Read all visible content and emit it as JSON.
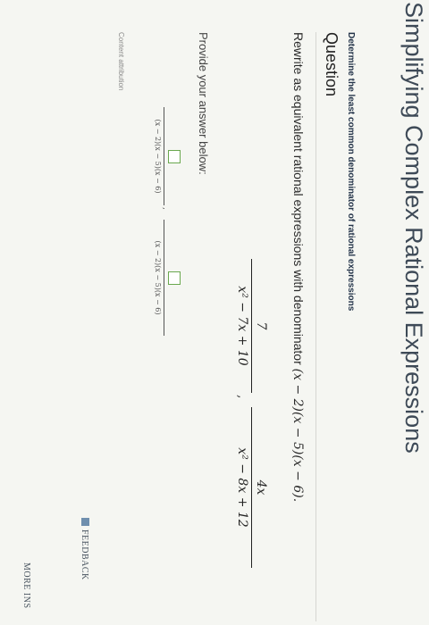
{
  "header": {
    "title": "Simplifying Complex Rational Expressions"
  },
  "question": {
    "subtopic": "Determine the least common denominator of rational expressions",
    "section_label": "Question",
    "prompt_text": "Rewrite as equivalent rational expressions with denominator ",
    "prompt_math": "(x − 2)(x − 5)(x − 6).",
    "fractions": [
      {
        "numerator": "7",
        "denominator": "x² − 7x + 10"
      },
      {
        "numerator": "4x",
        "denominator": "x² − 8x + 12"
      }
    ],
    "separator": ","
  },
  "answer": {
    "prompt": "Provide your answer below:",
    "denominators": [
      "(x − 2)(x − 5)(x − 6)",
      "(x − 2)(x − 5)(x − 6)"
    ],
    "separator": ","
  },
  "footer": {
    "attribution": "Content attribution",
    "feedback": "FEEDBACK",
    "more": "MORE INS"
  },
  "colors": {
    "input_border": "#6aa84f",
    "title": "#3e4a57"
  }
}
